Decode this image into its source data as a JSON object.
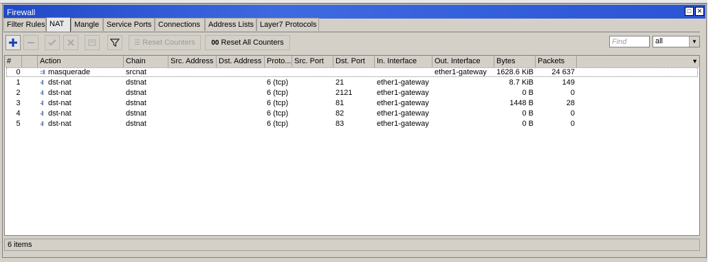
{
  "window": {
    "title": "Firewall"
  },
  "tabs": [
    {
      "label": "Filter Rules",
      "active": false
    },
    {
      "label": "NAT",
      "active": true
    },
    {
      "label": "Mangle",
      "active": false
    },
    {
      "label": "Service Ports",
      "active": false
    },
    {
      "label": "Connections",
      "active": false
    },
    {
      "label": "Address Lists",
      "active": false
    },
    {
      "label": "Layer7 Protocols",
      "active": false
    }
  ],
  "toolbar": {
    "reset_counters_label": "Reset Counters",
    "reset_all_counters_label": "Reset All Counters",
    "reset_all_icon_text": "00",
    "find_placeholder": "Find",
    "filter_value": "all"
  },
  "table": {
    "columns": [
      "#",
      "",
      "Action",
      "Chain",
      "Src. Address",
      "Dst. Address",
      "Proto...",
      "Src. Port",
      "Dst. Port",
      "In. Interface",
      "Out. Interface",
      "Bytes",
      "Packets"
    ],
    "rows": [
      {
        "num": "0",
        "action": "masquerade",
        "chain": "srcnat",
        "src_address": "",
        "dst_address": "",
        "protocol": "",
        "src_port": "",
        "dst_port": "",
        "in_interface": "",
        "out_interface": "ether1-gateway",
        "bytes": "1628.6 KiB",
        "packets": "24 637"
      },
      {
        "num": "1",
        "action": "dst-nat",
        "chain": "dstnat",
        "src_address": "",
        "dst_address": "",
        "protocol": "6 (tcp)",
        "src_port": "",
        "dst_port": "21",
        "in_interface": "ether1-gateway",
        "out_interface": "",
        "bytes": "8.7 KiB",
        "packets": "149"
      },
      {
        "num": "2",
        "action": "dst-nat",
        "chain": "dstnat",
        "src_address": "",
        "dst_address": "",
        "protocol": "6 (tcp)",
        "src_port": "",
        "dst_port": "2121",
        "in_interface": "ether1-gateway",
        "out_interface": "",
        "bytes": "0 B",
        "packets": "0"
      },
      {
        "num": "3",
        "action": "dst-nat",
        "chain": "dstnat",
        "src_address": "",
        "dst_address": "",
        "protocol": "6 (tcp)",
        "src_port": "",
        "dst_port": "81",
        "in_interface": "ether1-gateway",
        "out_interface": "",
        "bytes": "1448 B",
        "packets": "28"
      },
      {
        "num": "4",
        "action": "dst-nat",
        "chain": "dstnat",
        "src_address": "",
        "dst_address": "",
        "protocol": "6 (tcp)",
        "src_port": "",
        "dst_port": "82",
        "in_interface": "ether1-gateway",
        "out_interface": "",
        "bytes": "0 B",
        "packets": "0"
      },
      {
        "num": "5",
        "action": "dst-nat",
        "chain": "dstnat",
        "src_address": "",
        "dst_address": "",
        "protocol": "6 (tcp)",
        "src_port": "",
        "dst_port": "83",
        "in_interface": "ether1-gateway",
        "out_interface": "",
        "bytes": "0 B",
        "packets": "0"
      }
    ]
  },
  "status": {
    "items": "6 items"
  },
  "colors": {
    "titlebar": "#2a54d4",
    "add_icon": "#1a3cb8"
  }
}
